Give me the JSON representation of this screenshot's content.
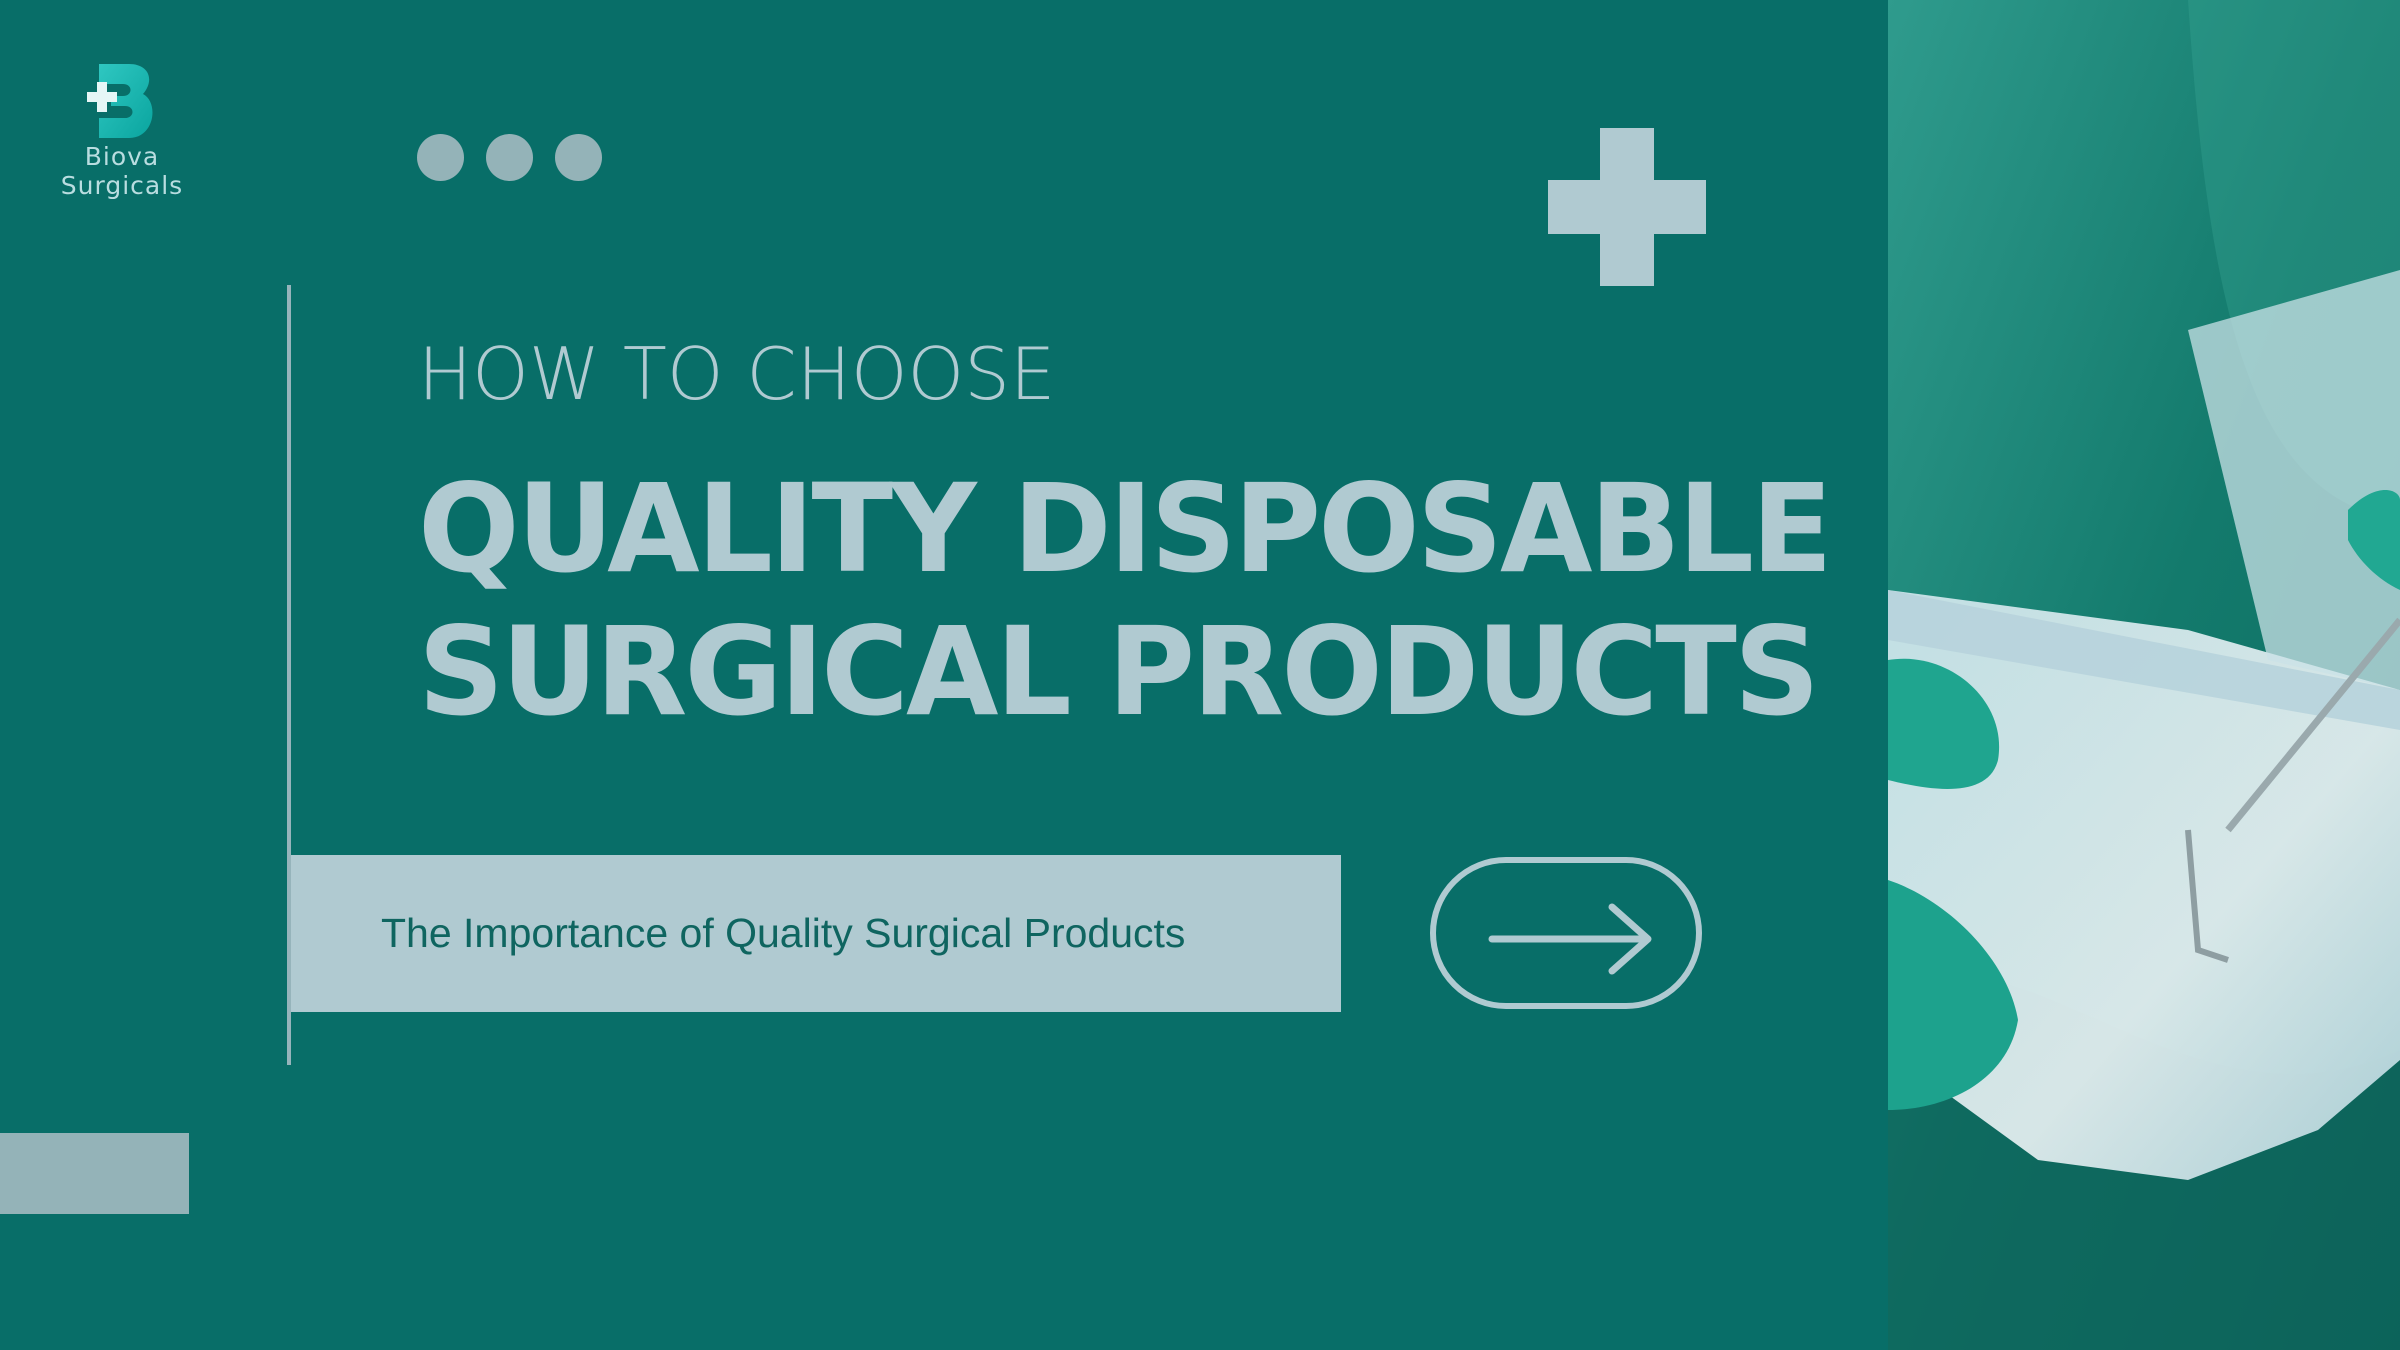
{
  "logo": {
    "line1": "Biova",
    "line2": "Surgicals",
    "icon": "cross-b-logo-icon"
  },
  "heading": {
    "eyebrow": "HOW TO CHOOSE",
    "title_line1": "QUALITY DISPOSABLE",
    "title_line2": "SURGICAL PRODUCTS"
  },
  "subtitle": "The Importance of Quality Surgical Products",
  "icons": {
    "arrow": "arrow-right-icon",
    "plus": "plus-icon"
  },
  "colors": {
    "background": "#086e68",
    "accent_light": "#b0cad1",
    "accent_muted": "#94b3b8",
    "subtitle_text": "#0f6560"
  }
}
